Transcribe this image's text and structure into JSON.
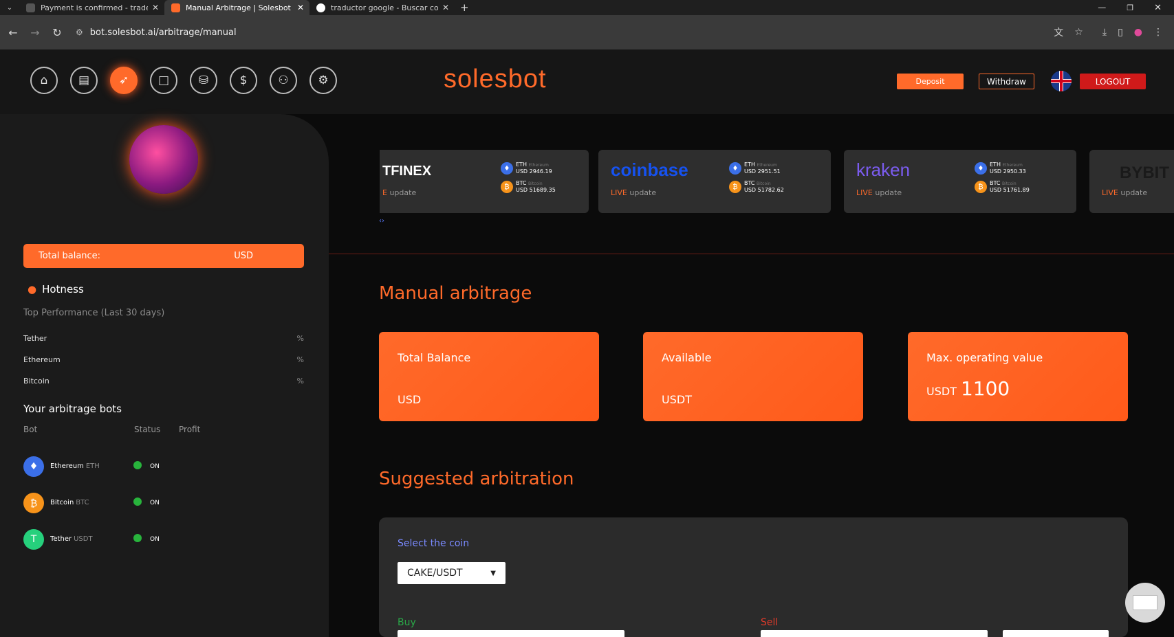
{
  "browser": {
    "tabs": [
      {
        "title": "Payment is confirmed - tradein",
        "active": false,
        "fav_color": "#555"
      },
      {
        "title": "Manual Arbitrage | Solesbot",
        "active": true,
        "fav_color": "#ff6a2a"
      },
      {
        "title": "traductor google - Buscar con G",
        "active": false,
        "fav_color": "#4285f4"
      }
    ],
    "url": "bot.solesbot.ai/arbitrage/manual"
  },
  "header": {
    "logo": "solesbot",
    "nav_icons": [
      "home-icon",
      "chart-icon",
      "rocket-icon",
      "square-icon",
      "coins-icon",
      "exchange-icon",
      "add-user-icon",
      "settings-icon"
    ],
    "active_nav": 2,
    "deposit_label": "Deposit",
    "withdraw_label": "Withdraw",
    "logout_label": "LOGOUT"
  },
  "sidebar": {
    "total_balance_label": "Total balance:",
    "total_balance_currency": "USD",
    "hotness_title": "Hotness",
    "hotness_subtitle": "Top Performance (Last 30 days)",
    "performance": [
      {
        "name": "Tether",
        "pct": "%"
      },
      {
        "name": "Ethereum",
        "pct": "%"
      },
      {
        "name": "Bitcoin",
        "pct": "%"
      }
    ],
    "bots_title": "Your arbitrage bots",
    "bots_headers": {
      "bot": "Bot",
      "status": "Status",
      "profit": "Profit"
    },
    "bots": [
      {
        "name": "Ethereum",
        "symbol": "ETH",
        "status": "ON",
        "color": "#3b6fe8",
        "glyph": "♦"
      },
      {
        "name": "Bitcoin",
        "symbol": "BTC",
        "status": "ON",
        "color": "#f7931a",
        "glyph": "₿"
      },
      {
        "name": "Tether",
        "symbol": "USDT",
        "status": "ON",
        "color": "#26d07c",
        "glyph": "T"
      }
    ]
  },
  "exchanges": [
    {
      "name": "TFINEX",
      "live": "E",
      "update": "update",
      "eth_label": "ETH",
      "eth_sub": "Ethereum",
      "eth_price": "USD 2946.19",
      "btc_label": "BTC",
      "btc_sub": "Bitcoin",
      "btc_price": "USD 51689.35",
      "color": "#ffffff"
    },
    {
      "name": "coinbase",
      "live": "LIVE",
      "update": "update",
      "eth_label": "ETH",
      "eth_sub": "Ethereum",
      "eth_price": "USD 2951.51",
      "btc_label": "BTC",
      "btc_sub": "Bitcoin",
      "btc_price": "USD 51782.62",
      "color": "#1652f0"
    },
    {
      "name": "kraken",
      "live": "LIVE",
      "update": "update",
      "eth_label": "ETH",
      "eth_sub": "Ethereum",
      "eth_price": "USD 2950.33",
      "btc_label": "BTC",
      "btc_sub": "Bitcoin",
      "btc_price": "USD 51761.89",
      "color": "#7b5cf0"
    },
    {
      "name": "BYBIT",
      "live": "LIVE",
      "update": "update",
      "color": "#1a1a1a"
    }
  ],
  "main": {
    "title": "Manual arbitrage",
    "stats": [
      {
        "label": "Total Balance",
        "currency": "USD",
        "value": ""
      },
      {
        "label": "Available",
        "currency": "USDT",
        "value": ""
      },
      {
        "label": "Max. operating value",
        "currency": "USDT",
        "value": "1100"
      }
    ],
    "suggest_title": "Suggested arbitration",
    "select_label": "Select the coin",
    "selected_coin": "CAKE/USDT",
    "buy_label": "Buy",
    "sell_label": "Sell"
  },
  "colors": {
    "accent": "#ff6a2a",
    "buy": "#2aa848",
    "sell": "#e03a2a"
  }
}
